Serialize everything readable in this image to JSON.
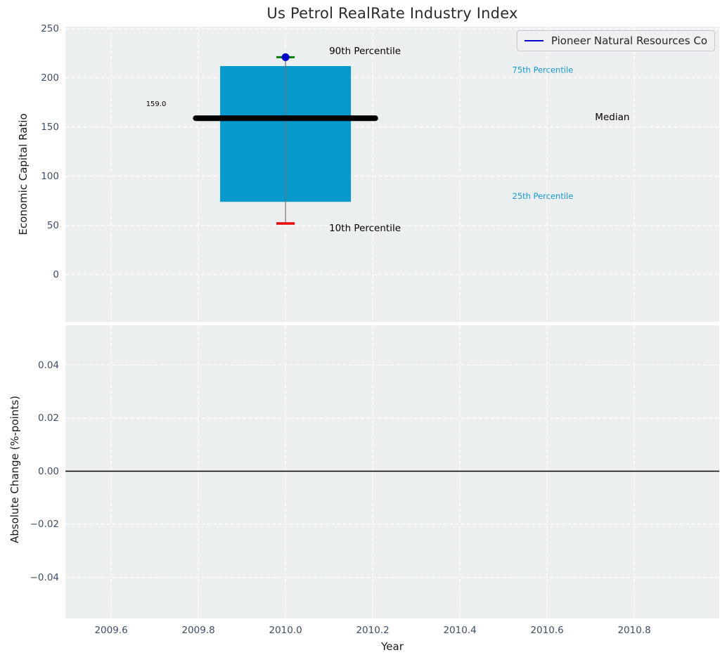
{
  "chart_data": {
    "type": "boxplot",
    "title": "Us Petrol RealRate Industry Index",
    "legend": {
      "label": "Pioneer Natural Resources Co",
      "line_color": "#0000cd"
    },
    "x_axis": {
      "label": "Year",
      "lim": [
        2009.495,
        2010.995
      ],
      "ticks": [
        2009.6,
        2009.8,
        2010.0,
        2010.2,
        2010.4,
        2010.6,
        2010.8
      ],
      "tick_labels": [
        "2009.6",
        "2009.8",
        "2010.0",
        "2010.2",
        "2010.4",
        "2010.6",
        "2010.8"
      ]
    },
    "panels": [
      {
        "name": "economic-capital-ratio",
        "ylabel": "Economic Capital Ratio",
        "ylim": [
          -48,
          252
        ],
        "yticks": [
          {
            "v": 0,
            "label": "0"
          },
          {
            "v": 50,
            "label": "50"
          },
          {
            "v": 100,
            "label": "100"
          },
          {
            "v": 150,
            "label": "150"
          },
          {
            "v": 200,
            "label": "200"
          },
          {
            "v": 250,
            "label": "250"
          }
        ],
        "series": [
          {
            "name": "Pioneer Natural Resources Co",
            "x": 2010.0,
            "p10": 52,
            "p25": 74,
            "median": 159,
            "p75": 212,
            "p90": 221,
            "median_label": "159.0"
          }
        ],
        "style": {
          "box_fill": "#0599cc",
          "median_color": "#000000",
          "stem_color": "#6f6f6f",
          "p90_cap_color": "#007d00",
          "p90_dot_color": "#0000cd",
          "p10_cap_color": "#e8000b",
          "box_half": 0.15,
          "median_half": 0.206,
          "cap_half": 0.021
        },
        "annotations": [
          {
            "text": "90th Percentile",
            "x": 2010.1,
            "y": 227,
            "color": "#000000",
            "size": 13.5
          },
          {
            "text": "10th Percentile",
            "x": 2010.1,
            "y": 47,
            "color": "#000000",
            "size": 13.5
          },
          {
            "text": "75th Percentile",
            "x": 2010.52,
            "y": 208,
            "color": "#1899d1",
            "size": 11.5
          },
          {
            "text": "25th Percentile",
            "x": 2010.52,
            "y": 80,
            "color": "#1899d1",
            "size": 11.5
          },
          {
            "text": "Median",
            "x": 2010.71,
            "y": 160,
            "color": "#000000",
            "size": 13.5
          },
          {
            "text": "159.0",
            "x": 2009.68,
            "y": 173,
            "color": "#000000",
            "size": 10
          }
        ]
      },
      {
        "name": "absolute-change",
        "ylabel": "Absolute Change (%-points)",
        "ylim": [
          -0.0555,
          0.055
        ],
        "yticks": [
          {
            "v": 0.04,
            "label": "0.04"
          },
          {
            "v": 0.02,
            "label": "0.02"
          },
          {
            "v": 0.0,
            "label": "0.00"
          },
          {
            "v": -0.02,
            "label": "−0.02"
          },
          {
            "v": -0.04,
            "label": "−0.04"
          }
        ],
        "zero_line": 0.0
      }
    ]
  }
}
